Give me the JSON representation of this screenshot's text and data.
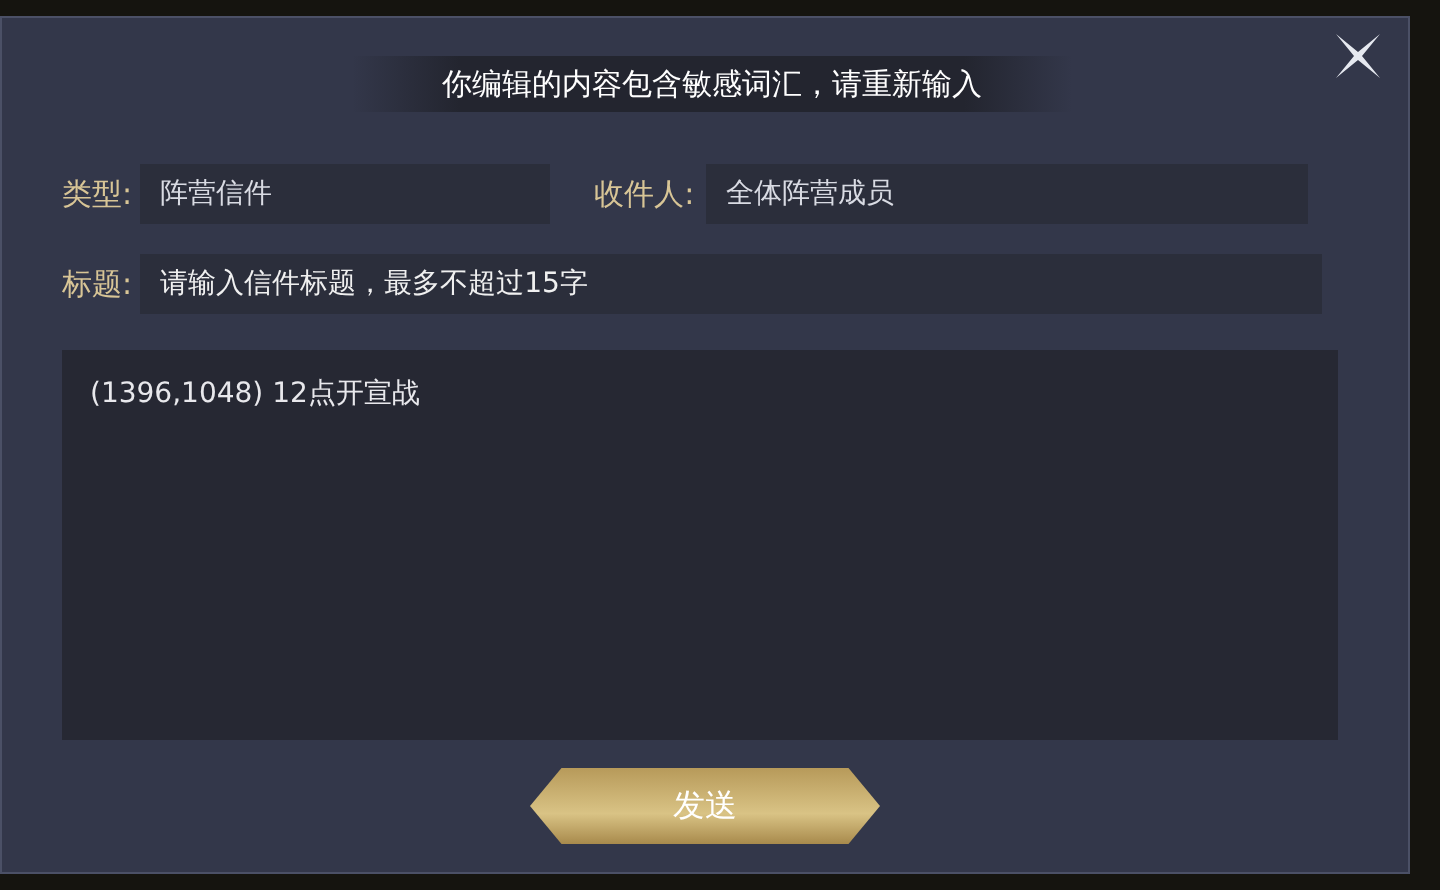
{
  "toast": {
    "text": "你编辑的内容包含敏感词汇，请重新输入"
  },
  "fields": [
    {
      "kind": "readonly",
      "label": "类型:",
      "value": "阵营信件"
    },
    {
      "kind": "readonly",
      "label": "收件人:",
      "value": "全体阵营成员"
    },
    {
      "kind": "input",
      "label": "标题:",
      "placeholder": "请输入信件标题，最多不超过15字"
    }
  ],
  "body": {
    "value": "(1396,1048) 12点开宣战"
  },
  "send_button": {
    "label": "发送"
  }
}
